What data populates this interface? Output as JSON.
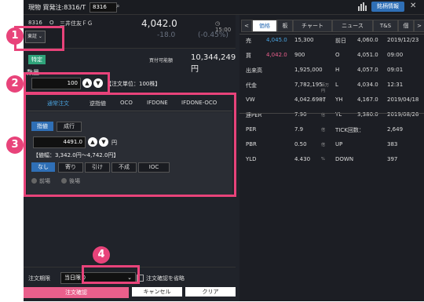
{
  "titlebar": {
    "title": "現物 買発注:8316/T",
    "code": "8316",
    "stock_info": "銘柄情報"
  },
  "stock": {
    "code": "8316",
    "market_mark": "O",
    "name": "三井住友ＦＧ",
    "price": "4,042.0",
    "time": "15:00",
    "change": "-18.0",
    "change_pct": "(-0.45%)",
    "market": "東証"
  },
  "order": {
    "account": "特定",
    "buying_power_label": "買付可能額",
    "buying_power": "10,344,249円",
    "qty_label": "数量",
    "qty": "100",
    "unit": "【注文単位：100株】"
  },
  "tabs": [
    "通常注文",
    "逆指値",
    "OCO",
    "IFDONE",
    "IFDONE-OCO"
  ],
  "price_type": {
    "limit": "指値",
    "market": "成行",
    "price": "4491.0",
    "yen": "円",
    "range": "【値幅：3,342.0円〜4,742.0円】"
  },
  "conditions": [
    "なし",
    "寄り",
    "引け",
    "不成",
    "IOC"
  ],
  "session": {
    "morning": "前場",
    "afternoon": "後場"
  },
  "bottom": {
    "period_label": "注文期限",
    "period": "当日限り",
    "confirm_skip": "注文確認を省略",
    "submit": "注文確認",
    "cancel": "キャンセル",
    "clear": "クリア"
  },
  "right_tabs": [
    "価格",
    "板",
    "チャート",
    "ニュース",
    "T&S",
    "個"
  ],
  "board_left": [
    {
      "label": "売",
      "a": "4,045.0",
      "b": "15,300",
      "a_color": "#4aa3df"
    },
    {
      "label": "買",
      "a": "4,042.0",
      "b": "900",
      "a_color": "#ea5f8c"
    },
    {
      "label": "出来高",
      "a": "",
      "b": "1,925,000"
    },
    {
      "label": "代金",
      "a": "",
      "b": "7,782,195",
      "unit": "百万円"
    },
    {
      "label": "VW",
      "a": "",
      "b": "4,042.6987",
      "unit": "円"
    },
    {
      "label": "連PER",
      "a": "",
      "b": "7.90",
      "unit": "倍"
    },
    {
      "label": "PER",
      "a": "",
      "b": "7.9",
      "unit": "倍"
    },
    {
      "label": "PBR",
      "a": "",
      "b": "0.50",
      "unit": "倍"
    },
    {
      "label": "YLD",
      "a": "",
      "b": "4.430",
      "unit": "%"
    }
  ],
  "board_right": [
    {
      "label": "前日",
      "a": "4,060.0",
      "b": "2019/12/23"
    },
    {
      "label": "O",
      "a": "4,051.0",
      "b": "09:00"
    },
    {
      "label": "H",
      "a": "4,057.0",
      "b": "09:01"
    },
    {
      "label": "L",
      "a": "4,034.0",
      "b": "12:31"
    },
    {
      "label": "YH",
      "a": "4,167.0",
      "b": "2019/04/18"
    },
    {
      "label": "YL",
      "a": "3,380.0",
      "b": "2019/08/26"
    },
    {
      "label": "TICK回数：",
      "a": "",
      "b": "2,649"
    },
    {
      "label": "UP",
      "a": "",
      "b": "383"
    },
    {
      "label": "DOWN",
      "a": "",
      "b": "397"
    }
  ],
  "callouts": [
    "1",
    "2",
    "3",
    "4"
  ],
  "colors": {
    "accent": "#e8437a",
    "blue": "#2f6fb6",
    "green": "#2fa37a"
  }
}
